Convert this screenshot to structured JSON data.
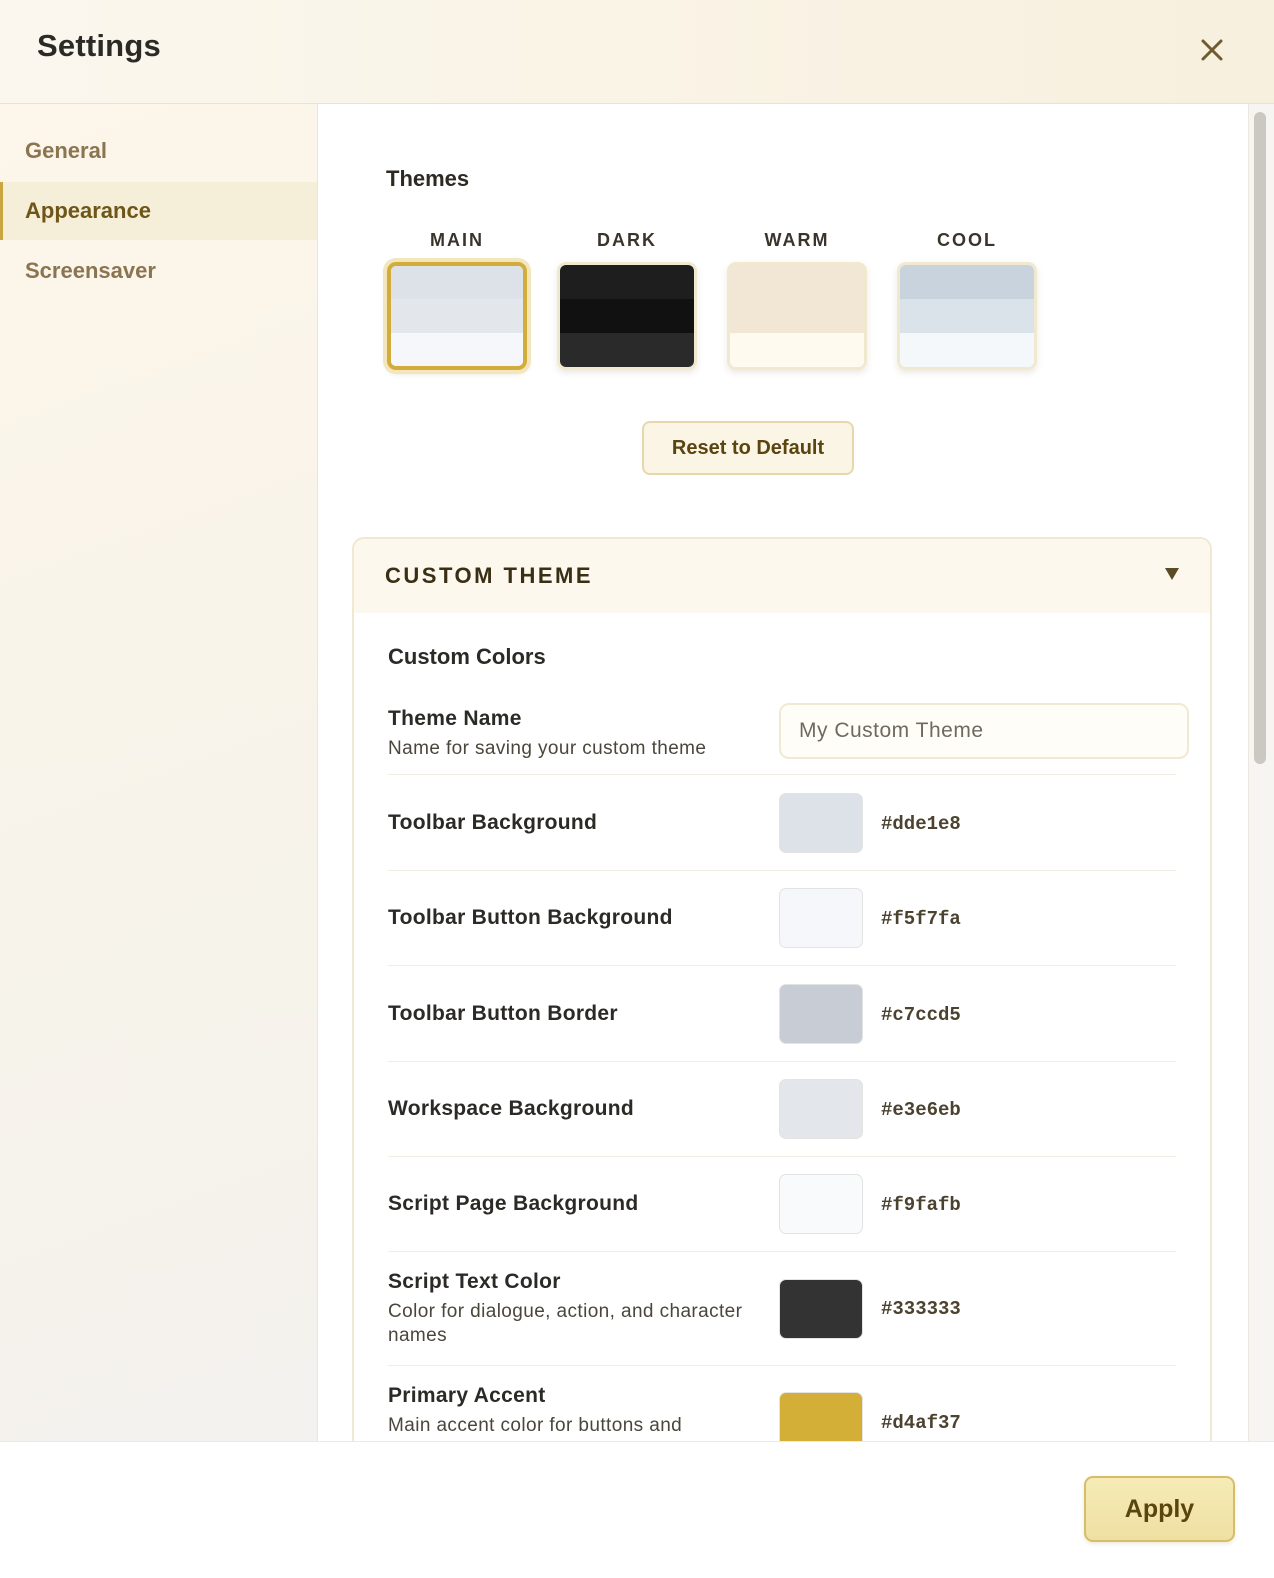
{
  "header": {
    "title": "Settings",
    "close_icon": "close-icon"
  },
  "sidebar": {
    "items": [
      {
        "label": "General",
        "active": false
      },
      {
        "label": "Appearance",
        "active": true
      },
      {
        "label": "Screensaver",
        "active": false
      }
    ]
  },
  "themes": {
    "title": "Themes",
    "options": [
      {
        "label": "MAIN",
        "selected": true,
        "colors": [
          "#dde1e8",
          "#e3e6eb",
          "#f5f7fa"
        ]
      },
      {
        "label": "DARK",
        "selected": false,
        "colors": [
          "#1e1e1e",
          "#111111",
          "#2a2a2a"
        ]
      },
      {
        "label": "WARM",
        "selected": false,
        "colors": [
          "#f2e6d5",
          "#f2e6d5",
          "#fffaf0"
        ]
      },
      {
        "label": "COOL",
        "selected": false,
        "colors": [
          "#c8d3de",
          "#dbe3ea",
          "#f5f8fb"
        ]
      }
    ],
    "reset_label": "Reset to Default"
  },
  "custom_theme": {
    "header": "CUSTOM THEME",
    "collapse_icon": "chevron-down-icon",
    "subtitle": "Custom Colors",
    "name_field": {
      "label": "Theme Name",
      "description": "Name for saving your custom theme",
      "placeholder": "My Custom Theme",
      "value": ""
    },
    "colors": [
      {
        "label": "Toolbar Background",
        "description": "",
        "hex": "#dde1e8"
      },
      {
        "label": "Toolbar Button Background",
        "description": "",
        "hex": "#f5f7fa"
      },
      {
        "label": "Toolbar Button Border",
        "description": "",
        "hex": "#c7ccd5"
      },
      {
        "label": "Workspace Background",
        "description": "",
        "hex": "#e3e6eb"
      },
      {
        "label": "Script Page Background",
        "description": "",
        "hex": "#f9fafb"
      },
      {
        "label": "Script Text Color",
        "description": "Color for dialogue, action, and character names",
        "hex": "#333333"
      },
      {
        "label": "Primary Accent",
        "description": "Main accent color for buttons and",
        "hex": "#d4af37"
      }
    ]
  },
  "footer": {
    "apply_label": "Apply"
  }
}
